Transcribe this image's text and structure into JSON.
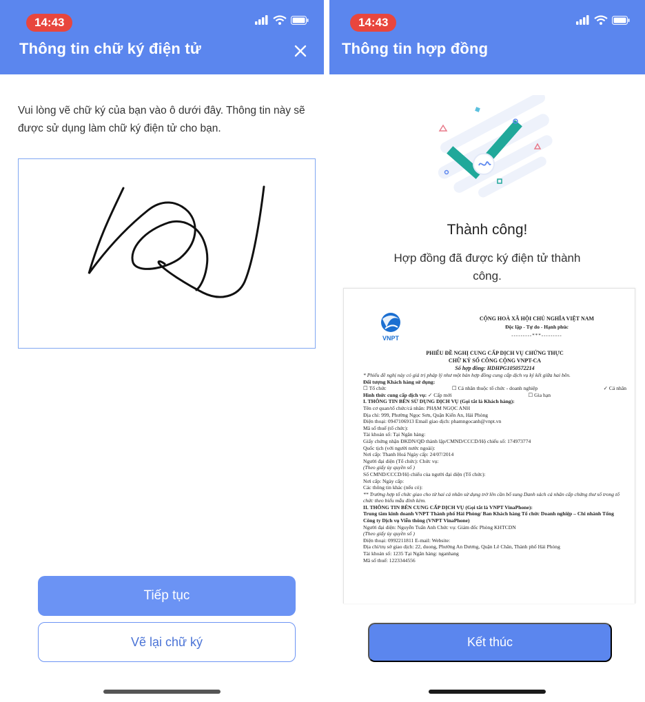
{
  "left": {
    "status": {
      "time": "14:43"
    },
    "header": {
      "title": "Thông tin chữ ký điện tử"
    },
    "instruction": "Vui lòng vẽ chữ ký của bạn vào ô dưới đây. Thông tin này sẽ được sử dụng làm chữ ký điện tử cho bạn.",
    "continue_label": "Tiếp tục",
    "redraw_label": "Vẽ lại chữ ký"
  },
  "right": {
    "status": {
      "time": "14:43"
    },
    "header": {
      "title": "Thông tin hợp đồng"
    },
    "success_title": "Thành công!",
    "success_message": "Hợp đồng đã được ký điện tử thành công.",
    "finish_label": "Kết thúc",
    "document": {
      "logo_text": "VNPT",
      "nation": "CỘNG HOÀ XÃ HỘI CHỦ NGHĨA VIỆT NAM",
      "motto": "Độc lập - Tự do - Hạnh phúc",
      "dash": "---------***---------",
      "form_title_1": "PHIẾU ĐỀ NGHỊ CUNG CẤP DỊCH VỤ CHỨNG THỰC",
      "form_title_2": "CHỮ KÝ SỐ CÔNG CỘNG VNPT-CA",
      "contract_no": "Số hợp đồng: HDHPG1050572214",
      "note": "* Phiếu đề nghị này có giá trị pháp lý như một bản hợp đồng cung cấp dịch vụ ký kết giữa hai bên.",
      "customer_type_label": "Đối tượng Khách hàng sử dụng:",
      "opt_org": "☐ Tổ chức",
      "opt_individual_org": "☐ Cá nhân thuộc tổ chức - doanh nghiệp",
      "opt_individual": "✓ Cá nhân",
      "service_form_label": "Hình thức cung cấp dịch vụ:",
      "opt_new": "✓ Cấp mới",
      "opt_renew": "☐ Gia hạn",
      "section1": "I. THÔNG TIN BÊN SỬ DỤNG DỊCH VỤ (Gọi tắt là Khách hàng):",
      "lines1": [
        "Tên cơ quan/tổ chức/cá nhân: PHẠM NGỌC ANH",
        "Địa chỉ: 999, Phường Ngọc Sơn, Quận Kiến An, Hải Phòng",
        "Điện thoại: 0947106913 Email giao dịch: phamngocanh@vnpt.vn",
        "Mã số thuế (tổ chức):",
        "Tài khoản số:   Tại Ngân hàng:",
        "Giấy chứng nhận ĐKDN/QĐ thành lập/CMND/CCCD/Hộ chiếu số: 174973774",
        "Quốc tịch (với người nước ngoài):",
        "Nơi cấp: Thanh Hoá Ngày cấp: 24/07/2014",
        "Người đại diện (Tổ chức):   Chức vụ:"
      ],
      "auth_note_1": "(Theo giấy ủy quyền số   )",
      "lines2": [
        "Số CMND/CCCD/Hộ chiếu của người đại diện (Tổ chức):",
        "Nơi cấp:   Ngày cấp:",
        "Các thông tin khác (nếu có):"
      ],
      "note2": "** Trường hợp tổ chức giao cho từ hai cá nhân sử dụng trở lên cần bổ sung Danh sách cá nhân cấp chứng thư số trong tổ chức theo biểu mẫu đính kèm.",
      "section2": "II. THÔNG TIN BÊN CUNG CẤP DỊCH VỤ (Gọi tắt là VNPT VinaPhone):",
      "provider": "Trung tâm kinh doanh   VNPT Thành phố Hải Phòng/ Ban Khách hàng Tổ chức Doanh nghiệp – Chi nhánh Tổng Công ty Dịch vụ Viễn thông (VNPT VinaPhone)",
      "rep": "Người đại diện: Nguyễn Tuấn Anh Chức vụ: Giám đốc Phòng KHTCDN",
      "auth_note_2": "(Theo giấy ủy quyền số   )",
      "lines3": [
        "Điện thoại: 0992211811 E-mail:   Website:",
        "Địa chỉ/trụ sở giao dịch:          22, duong, Phường An Dương, Quận Lê Chân, Thành phố Hải Phòng",
        "Tài khoản số: 1235 Tại Ngân hàng: nganhang",
        "Mã số thuế: 1223344556"
      ]
    }
  },
  "colors": {
    "header": "#5b86ee",
    "primary": "#6b93f4",
    "time_pill": "#e8463d",
    "check": "#20a89a"
  }
}
